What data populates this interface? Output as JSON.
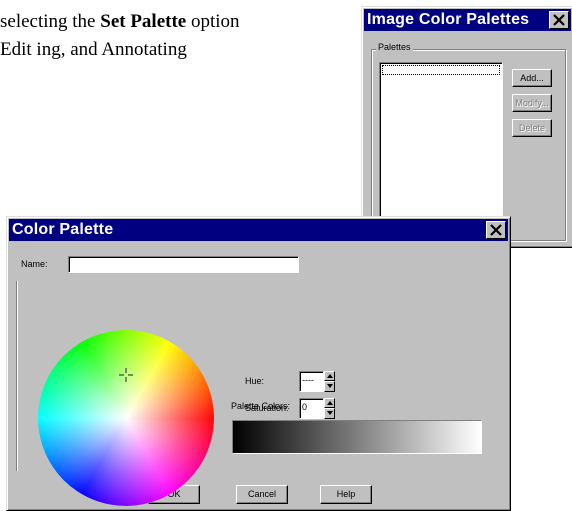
{
  "document": {
    "line1_prefix": "selecting the ",
    "line1_bold": "Set Palette",
    "line1_suffix": " option",
    "line2": "Edit ing, and Annotating"
  },
  "palettes_dialog": {
    "title": "Image Color Palettes",
    "group_label": "Palettes",
    "buttons": {
      "add": "Add...",
      "modify": "Modify...",
      "delete": "Delete"
    },
    "list_items": []
  },
  "color_palette_dialog": {
    "title": "Color Palette",
    "name_label": "Name:",
    "name_value": "",
    "hue_label": "Hue:",
    "hue_value": "----",
    "saturation_label": "Saturation:",
    "saturation_value": "0",
    "palette_colors_label": "Palette Colors:",
    "buttons": {
      "ok": "OK",
      "cancel": "Cancel",
      "help": "Help"
    }
  },
  "colors": {
    "titlebar": "#000080",
    "face": "#c0c0c0"
  },
  "icons": {
    "close": "close-icon",
    "spin_up": "arrow-up-icon",
    "spin_down": "arrow-down-icon",
    "crosshair": "crosshair-icon"
  }
}
